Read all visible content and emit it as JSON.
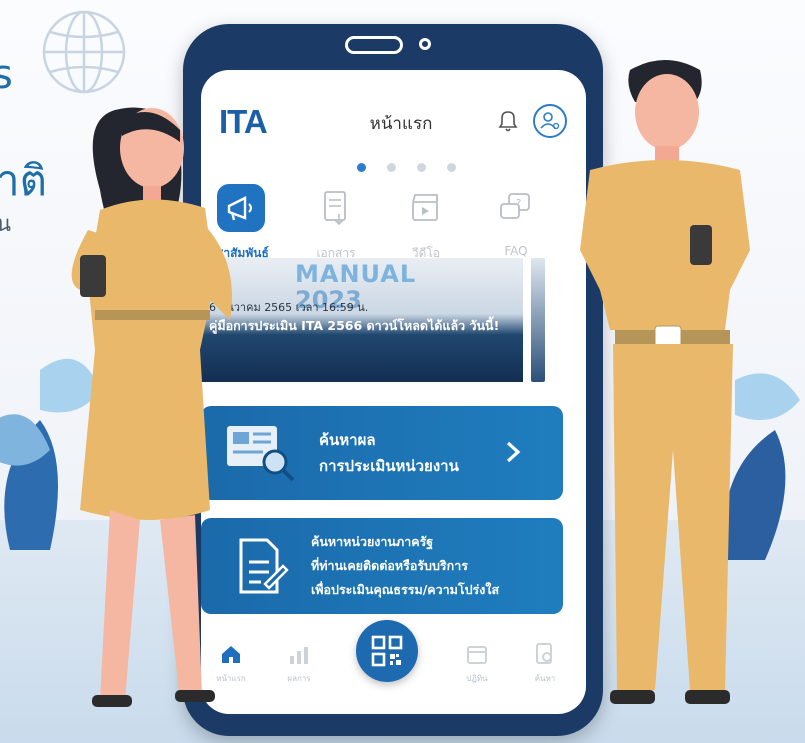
{
  "background": {
    "side_text_1": "s",
    "side_text_2": "าติ",
    "side_text_3": "น"
  },
  "app": {
    "logo_text": "ITA",
    "page_title": "หน้าแรก",
    "carousel_dots": 4,
    "active_dot": 0
  },
  "tabs": [
    {
      "label": "ชาสัมพันธ์",
      "icon": "megaphone-icon",
      "active": true
    },
    {
      "label": "เอกสาร",
      "icon": "document-icon",
      "active": false
    },
    {
      "label": "วีดีโอ",
      "icon": "clapperboard-icon",
      "active": false
    },
    {
      "label": "FAQ",
      "icon": "chat-question-icon",
      "active": false
    }
  ],
  "banner": {
    "big_line_1": "MANUAL",
    "big_line_2": "2023",
    "date": "6 ธันวาคม 2565 เวลา 16:59 น.",
    "headline": "คู่มือการประเมิน ITA 2566 ดาวน์โหลดได้แล้ว วันนี้!"
  },
  "card_search_results": {
    "line1": "ค้นหาผล",
    "line2": "การประเมินหน่วยงาน"
  },
  "card_search_agency": {
    "line1": "ค้นหาหน่วยงานภาครัฐ",
    "line2": "ที่ท่านเคยติดต่อหรือรับบริการ",
    "line3": "เพื่อประเมินคุณธรรม/ความโปร่งใส"
  },
  "bottom_nav": [
    {
      "icon": "home-icon",
      "label": "หน้าแรก"
    },
    {
      "icon": "chart-icon",
      "label": "ผลการ"
    },
    {
      "icon": "qr-code-icon",
      "label": ""
    },
    {
      "icon": "calendar-icon",
      "label": "ปฏิทิน"
    },
    {
      "icon": "search-doc-icon",
      "label": "ค้นหา"
    }
  ],
  "colors": {
    "primary": "#1f6fbf",
    "phone_frame": "#1c3a66",
    "uniform": "#e9b86a",
    "card": "#1b6aaa"
  }
}
